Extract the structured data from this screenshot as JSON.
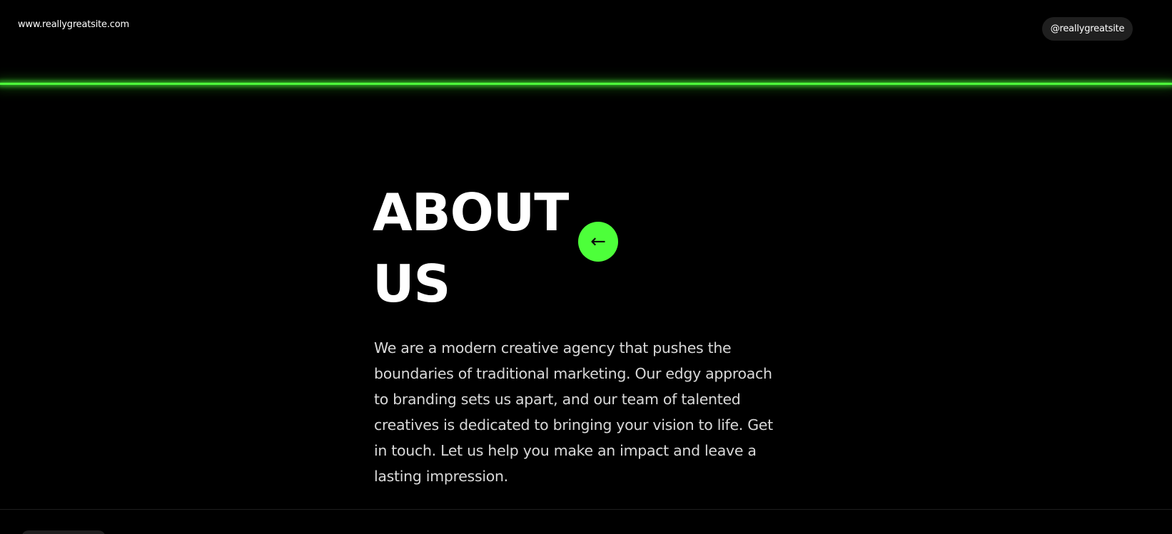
{
  "header": {
    "site_url": "www.reallygreatsite.com",
    "social_handle": "@reallygreatsite"
  },
  "hero": {
    "title_line1": "ABOUT",
    "title_line2": "US",
    "back_button_icon": "←",
    "description": "We are a modern creative agency that pushes the boundaries of traditional marketing. Our edgy approach to branding sets us apart, and our team of talented creatives is dedicated to bringing your vision to life. Get in touch. Let us help you make an impact and leave a lasting impression."
  },
  "colors": {
    "background": "#000000",
    "accent": "#4dff3a",
    "text": "#ffffff",
    "body_text": "#d9d9d9",
    "pill": "#1f1f1f"
  },
  "icons": {
    "back_button": "arrow-left-icon"
  }
}
